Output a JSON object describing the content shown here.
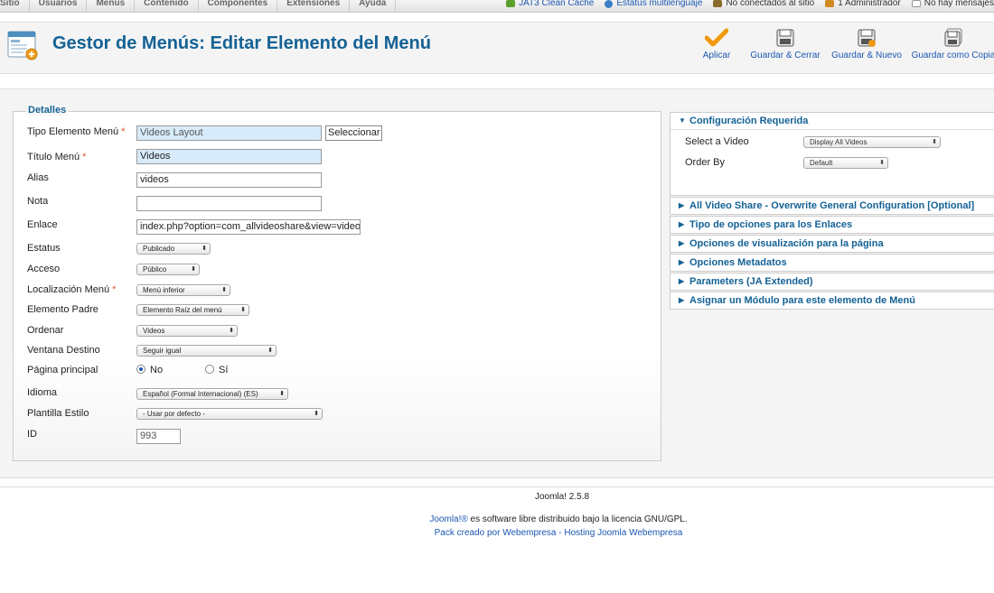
{
  "top_menu": [
    "Sitio",
    "Usuarios",
    "Menús",
    "Contenido",
    "Componentes",
    "Extensiones",
    "Ayuda"
  ],
  "status_bar": [
    {
      "label": "JAT3 Clean Cache",
      "icon": "cache-icon",
      "color": "#5aa02c"
    },
    {
      "label": "Estatus multilenguaje",
      "icon": "globe-icon",
      "color": "#3b7fc4"
    },
    {
      "label": "No conectados al sitio",
      "icon": "users-icon",
      "color": "#8a6a2a"
    },
    {
      "label": "1 Administrador",
      "icon": "admin-icon",
      "color": "#d08a20"
    },
    {
      "label": "No hay mensajes",
      "icon": "mail-icon",
      "color": "#aaaaaa"
    }
  ],
  "page_title": "Gestor de Menús: Editar Elemento del Menú",
  "toolbar": {
    "apply": "Aplicar",
    "save_close": "Guardar & Cerrar",
    "save_new": "Guardar & Nuevo",
    "save_copy": "Guardar como Copia"
  },
  "details": {
    "legend": "Detalles",
    "fields": {
      "type": {
        "label": "Tipo Elemento Menú",
        "value": "Videos Layout",
        "button": "Seleccionar"
      },
      "title": {
        "label": "Título Menú",
        "value": "Videos"
      },
      "alias": {
        "label": "Alias",
        "value": "videos"
      },
      "note": {
        "label": "Nota",
        "value": ""
      },
      "link": {
        "label": "Enlace",
        "value": "index.php?option=com_allvideoshare&view=videos"
      },
      "status": {
        "label": "Estatus",
        "value": "Publicado"
      },
      "access": {
        "label": "Acceso",
        "value": "Público"
      },
      "menu_location": {
        "label": "Localización Menú",
        "value": "Menú inferior"
      },
      "parent": {
        "label": "Elemento Padre",
        "value": "Elemento Raíz del menú"
      },
      "ordering": {
        "label": "Ordenar",
        "value": "Videos"
      },
      "target_window": {
        "label": "Ventana Destino",
        "value": "Seguir igual"
      },
      "home": {
        "label": "Página principal",
        "options": [
          "No",
          "Sí"
        ],
        "selected": "No"
      },
      "language": {
        "label": "Idioma",
        "value": "Español (Formal Internacional) (ES)"
      },
      "template_style": {
        "label": "Plantilla Estilo",
        "value": "- Usar por defecto -"
      },
      "id": {
        "label": "ID",
        "value": "993"
      }
    }
  },
  "right_panel": {
    "required": {
      "title": "Configuración Requerida",
      "select_video_label": "Select a Video",
      "select_video_value": "Display All Videos",
      "order_by_label": "Order By",
      "order_by_value": "Default"
    },
    "sections": [
      "All Video Share - Overwrite General Configuration [Optional]",
      "Tipo de opciones para los Enlaces",
      "Opciones de visualización para la página",
      "Opciones Metadatos",
      "Parameters (JA Extended)",
      "Asignar un Módulo para este elemento de Menú"
    ]
  },
  "footer": {
    "version": "Joomla! 2.5.8",
    "license_link": "Joomla!®",
    "license_text": " es software libre distribuido bajo la licencia GNU/GPL.",
    "credits": "Pack creado por Webempresa - Hosting Joomla Webempresa"
  }
}
